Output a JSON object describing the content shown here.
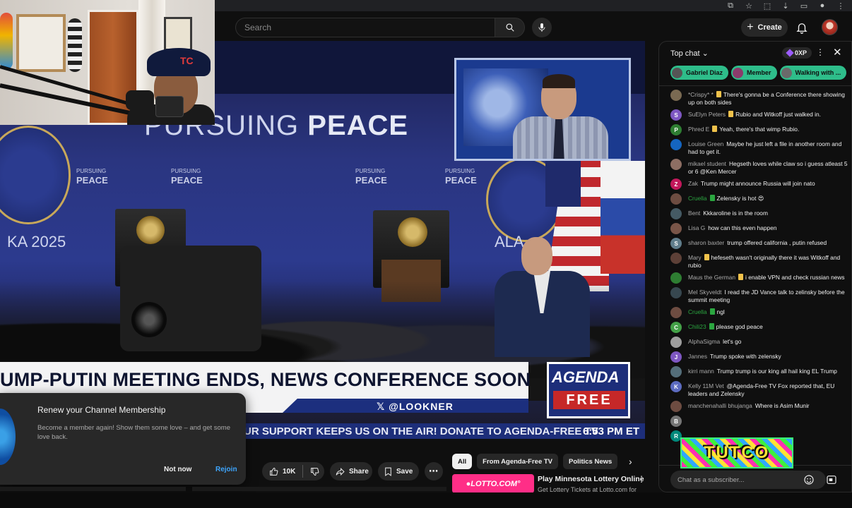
{
  "header": {
    "search_placeholder": "Search",
    "create_label": "Create"
  },
  "video": {
    "backdrop_title_a": "PURSUING",
    "backdrop_title_b": "PEACE",
    "small_top": "PURSUING",
    "small_bottom": "PEACE",
    "year_text": "KA 2025",
    "alas_text": "ALA",
    "headline": "UMP-PUTIN MEETING ENDS, NEWS CONFERENCE SOON",
    "handle": "𝕏 @LOOKNER",
    "logo_top": "AGENDA",
    "logo_bottom": "FREE",
    "ticker_text": "UR SUPPORT KEEPS US ON THE AIR! DONATE TO AGENDA-FREE TV",
    "ticker_time": "6:53 PM ET",
    "webcam_cap_logo": "TC"
  },
  "popup": {
    "title": "Renew your Channel Membership",
    "body": "Become a member again! Show them some love – and get some love back.",
    "not_now": "Not now",
    "rejoin": "Rejoin"
  },
  "actions": {
    "like_count": "10K",
    "share": "Share",
    "save": "Save"
  },
  "chips": [
    "All",
    "From Agenda-Free TV",
    "Politics News"
  ],
  "ad": {
    "logo": "●LOTTO.COM°",
    "title": "Play Minnesota Lottery Online",
    "sub": "Get Lottery Tickets at Lotto.com for"
  },
  "chat": {
    "title": "Top chat",
    "xp": "0XP",
    "pinned": [
      "Gabriel Diaz",
      "Member",
      "Walking with ..."
    ],
    "messages": [
      {
        "initial": "",
        "name": "*Crispy* *",
        "name_color": "gold",
        "text": "There's gonna be a Conference there showing up on both sides",
        "avatar_color": "#7a6a52"
      },
      {
        "initial": "S",
        "name": "SuElyn Peters",
        "name_color": "gold",
        "text": "Rubio and Witkoff just walked in.",
        "avatar_color": "#7e57c2"
      },
      {
        "initial": "P",
        "name": "Phred E",
        "name_color": "gold",
        "text": "Yeah, there's that wimp Rubio.",
        "avatar_color": "#2e7d32"
      },
      {
        "initial": "",
        "name": "Louise Green",
        "name_color": "grey",
        "text": "Maybe he just left a file in another room and had to get it.",
        "avatar_color": "#1565c0"
      },
      {
        "initial": "",
        "name": "mikael student",
        "name_color": "grey",
        "text": "Hegseth loves while claw so i guess atleast 5 or 6 @Ken Mercer",
        "avatar_color": "#8d6e63"
      },
      {
        "initial": "Z",
        "name": "Zak",
        "name_color": "grey",
        "text": "Trump might announce Russia will join nato",
        "avatar_color": "#c2185b"
      },
      {
        "initial": "",
        "name": "Cruella",
        "name_color": "green",
        "text": "Zelensky is hot 😍",
        "avatar_color": "#6d4c41"
      },
      {
        "initial": "",
        "name": "Bent",
        "name_color": "grey",
        "text": "Kkkaroline is in the room",
        "avatar_color": "#455a64"
      },
      {
        "initial": "",
        "name": "Lisa G",
        "name_color": "grey",
        "text": "how can this even happen",
        "avatar_color": "#795548"
      },
      {
        "initial": "S",
        "name": "sharon baxter",
        "name_color": "grey",
        "text": "trump offered california , putin refused",
        "avatar_color": "#607d8b"
      },
      {
        "initial": "",
        "name": "Mary",
        "name_color": "gold",
        "text": "hefeseth wasn't originally there it was Witkoff and rubio",
        "avatar_color": "#5d4037"
      },
      {
        "initial": "",
        "name": "Maus the German",
        "name_color": "gold",
        "text": "i enable VPN and check russian news",
        "avatar_color": "#2e7d32"
      },
      {
        "initial": "",
        "name": "Mel Skyveldt",
        "name_color": "grey",
        "text": "I read the JD Vance talk to zelinsky before the summit meeting",
        "avatar_color": "#37474f"
      },
      {
        "initial": "",
        "name": "Cruella",
        "name_color": "green",
        "text": "ngl",
        "avatar_color": "#6d4c41"
      },
      {
        "initial": "C",
        "name": "Chili23",
        "name_color": "green",
        "text": "please god peace",
        "avatar_color": "#43a047"
      },
      {
        "initial": "",
        "name": "AlphaSigma",
        "name_color": "grey",
        "text": "let's go",
        "avatar_color": "#9e9e9e"
      },
      {
        "initial": "J",
        "name": "Jannes",
        "name_color": "grey",
        "text": "Trump spoke with zelensky",
        "avatar_color": "#7e57c2"
      },
      {
        "initial": "",
        "name": "kirri mann",
        "name_color": "grey",
        "text": "Trump trump is our king all hail king EL Trump",
        "avatar_color": "#546e7a"
      },
      {
        "initial": "K",
        "name": "Kelly 11M Vet",
        "name_color": "grey",
        "text": "@Agenda-Free TV Fox reported that, EU leaders and Zelensky",
        "avatar_color": "#5c6bc0"
      },
      {
        "initial": "",
        "name": "manchenahalli bhujanga",
        "name_color": "grey",
        "text": "Where is Asim Munir",
        "avatar_color": "#6d4c41"
      },
      {
        "initial": "B",
        "name": "",
        "name_color": "grey",
        "text": "",
        "avatar_color": "#757575"
      },
      {
        "initial": "R",
        "name": "",
        "name_color": "grey",
        "text": "",
        "avatar_color": "#00897b"
      }
    ],
    "sticker_text": "TUTCO",
    "input_placeholder": "Chat as a subscriber..."
  }
}
